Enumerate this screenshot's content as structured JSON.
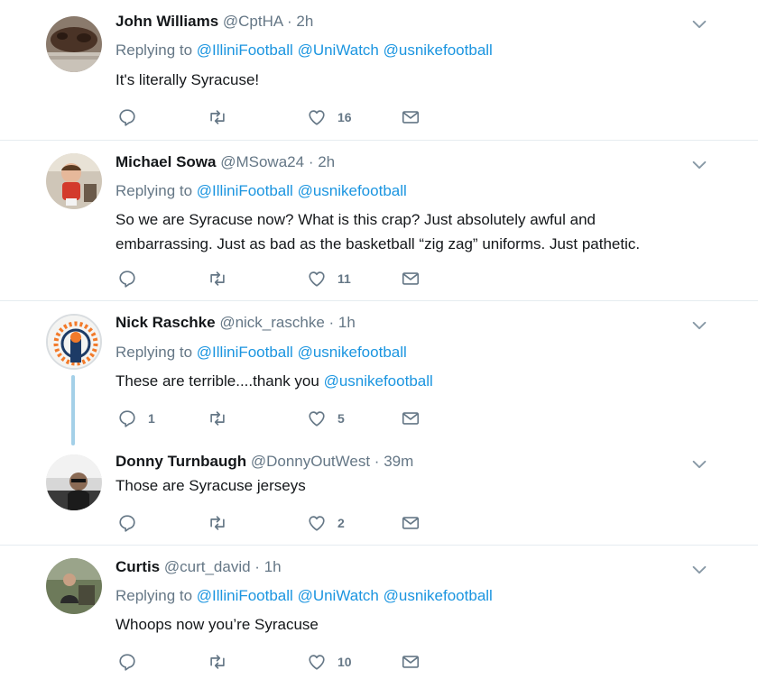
{
  "tweets": [
    {
      "name": "John Williams",
      "handle": "@CptHA",
      "dot": "·",
      "time": "2h",
      "replying_prefix": "Replying to",
      "replying_to": [
        "@IlliniFootball",
        "@UniWatch",
        "@usnikefootball"
      ],
      "text_lines": [
        "It's literally Syracuse!"
      ],
      "replies": "",
      "likes": "16"
    },
    {
      "name": "Michael Sowa",
      "handle": "@MSowa24",
      "dot": "·",
      "time": "2h",
      "replying_prefix": "Replying to",
      "replying_to": [
        "@IlliniFootball",
        "@usnikefootball"
      ],
      "text_lines": [
        "So we are Syracuse now? What is this crap? Just absolutely awful and",
        "embarrassing. Just as bad as the basketball “zig zag” uniforms. Just pathetic."
      ],
      "replies": "",
      "likes": "11"
    },
    {
      "name": "Nick Raschke",
      "handle": "@nick_raschke",
      "dot": "·",
      "time": "1h",
      "replying_prefix": "Replying to",
      "replying_to": [
        "@IlliniFootball",
        "@usnikefootball"
      ],
      "text_plain": "These are terrible....thank you ",
      "text_mention": "@usnikefootball",
      "replies": "1",
      "likes": "5"
    },
    {
      "name": "Donny Turnbaugh",
      "handle": "@DonnyOutWest",
      "dot": "·",
      "time": "39m",
      "text_lines": [
        "Those are Syracuse jerseys"
      ],
      "replies": "",
      "likes": "2"
    },
    {
      "name": "Curtis",
      "handle": "@curt_david",
      "dot": "·",
      "time": "1h",
      "replying_prefix": "Replying to",
      "replying_to": [
        "@IlliniFootball",
        "@UniWatch",
        "@usnikefootball"
      ],
      "text_lines": [
        "Whoops now you’re Syracuse"
      ],
      "replies": "",
      "likes": "10"
    }
  ],
  "icons": {
    "reply": "reply-icon",
    "retweet": "retweet-icon",
    "like": "heart-icon",
    "dm": "envelope-icon",
    "caret": "chevron-down-icon"
  },
  "colors": {
    "text": "#14171a",
    "secondary": "#657786",
    "link": "#1b95e0",
    "divider": "#e6ecf0",
    "thread_line": "#a4d0e8"
  }
}
